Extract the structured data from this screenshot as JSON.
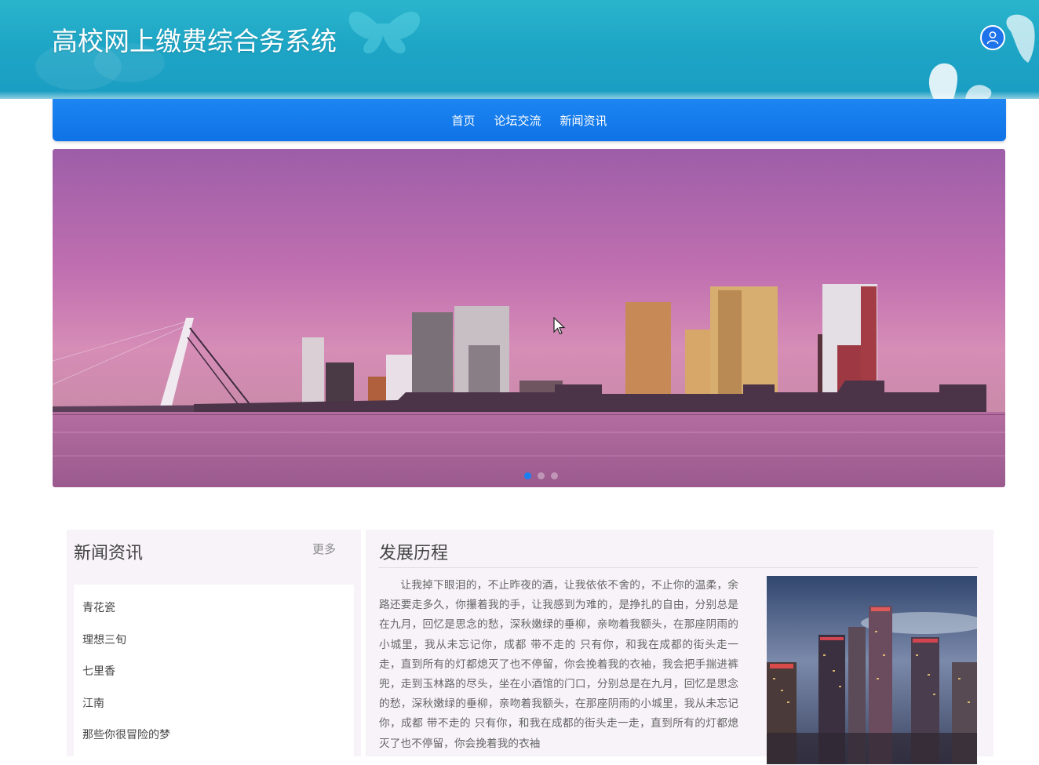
{
  "header": {
    "title": "高校网上缴费综合务系统",
    "user_icon": "user-icon"
  },
  "nav": {
    "items": [
      {
        "label": "首页"
      },
      {
        "label": "论坛交流"
      },
      {
        "label": "新闻资讯"
      }
    ]
  },
  "banner": {
    "slide_count": 3,
    "active_slide": 1
  },
  "news": {
    "heading": "新闻资讯",
    "more": "更多",
    "items": [
      "青花瓷",
      "理想三旬",
      "七里香",
      "江南",
      "那些你很冒险的梦"
    ]
  },
  "history": {
    "heading": "发展历程",
    "text": "让我掉下眼泪的，不止昨夜的酒，让我依依不舍的，不止你的温柔，余路还要走多久，你攥着我的手，让我感到为难的，是挣扎的自由，分别总是在九月，回忆是思念的愁，深秋嫩绿的垂柳，亲吻着我额头，在那座阴雨的小城里，我从未忘记你，成都 带不走的 只有你，和我在成都的街头走一走，直到所有的灯都熄灭了也不停留，你会挽着我的衣袖，我会把手揣进裤兜，走到玉林路的尽头，坐在小酒馆的门口，分别总是在九月，回忆是思念的愁，深秋嫩绿的垂柳，亲吻着我额头，在那座阴雨的小城里，我从未忘记你，成都 带不走的 只有你，和我在成都的街头走一走，直到所有的灯都熄灭了也不停留，你会挽着我的衣袖"
  },
  "colors": {
    "header": "#1ea6c6",
    "nav": "#0f72e6",
    "accent": "#1c7ff0"
  }
}
